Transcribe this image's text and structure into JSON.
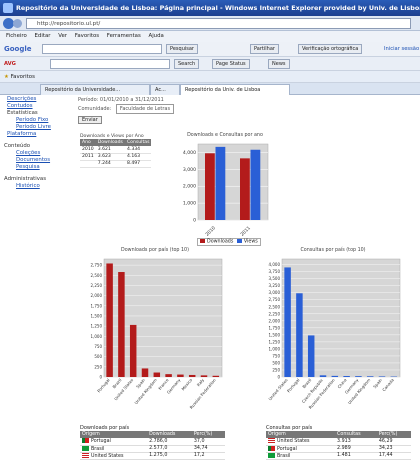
{
  "window": {
    "title": "Repositório da Universidade de Lisboa: Página principal - Windows Internet Explorer provided by Univ. de Lisboa - Reitoria"
  },
  "address": {
    "url": "http://repositorio.ul.pt/"
  },
  "menu": [
    "Ficheiro",
    "Editar",
    "Ver",
    "Favoritos",
    "Ferramentas",
    "Ajuda"
  ],
  "google": {
    "label": "Google",
    "search_label": "Pesquisar",
    "bookmarks": "Partilhar",
    "proof": "Verificação ortográfica",
    "signin": "Iniciar sessão"
  },
  "avg": {
    "label": "AVG",
    "search_btn": "Search",
    "status": "Page Status",
    "news": "News"
  },
  "favorites": {
    "label": "Favoritos"
  },
  "tabs": [
    "Repositório da Universidade...",
    "Ac...",
    "Repositório da Univ. de Lisboa"
  ],
  "sidebar": {
    "items": [
      {
        "label": "Descrições",
        "level": 1
      },
      {
        "label": "Contudos",
        "level": 1
      },
      {
        "label": "Estatísticas",
        "level": 1
      },
      {
        "label": "Período Fixo",
        "level": 2
      },
      {
        "label": "Período Livre",
        "level": 2
      },
      {
        "label": "Plataforma",
        "level": 1
      }
    ],
    "section2": "Conteúdo",
    "items2": [
      {
        "label": "Coleções"
      },
      {
        "label": "Documentos"
      },
      {
        "label": "Pesquisa"
      }
    ],
    "section3": "Administrativas",
    "items3": [
      {
        "label": "Histórico"
      }
    ]
  },
  "meta": {
    "period": "Período: 01/01/2010 a 31/12/2011",
    "community": "Comunidade:",
    "community_value": "Faculdade de Letras",
    "button": "Enviar"
  },
  "summary": {
    "title": "Downloads e Views por Ano",
    "headers": [
      "Ano",
      "Downloads",
      "Consultas"
    ],
    "rows": [
      [
        "2010",
        "3.621",
        "4.334"
      ],
      [
        "2011",
        "3.623",
        "4.163"
      ],
      [
        "",
        "7.244",
        "8.497"
      ]
    ]
  },
  "chart_data": [
    {
      "type": "bar",
      "title": "Downloads e Consultas por ano",
      "categories": [
        "2010",
        "2011"
      ],
      "series": [
        {
          "name": "Downloads",
          "values": [
            3950,
            3650
          ],
          "color": "#b31b1b"
        },
        {
          "name": "Views",
          "values": [
            4330,
            4160
          ],
          "color": "#2a5fd6"
        }
      ],
      "ylim": [
        0,
        4500
      ],
      "ticks": [
        "0",
        "1,000",
        "2,000",
        "3,000",
        "4,000"
      ]
    },
    {
      "type": "bar",
      "title": "Downloads por país (top 10)",
      "categories": [
        "Portugal",
        "Brazil",
        "United States",
        "Spain",
        "United Kingdom",
        "France",
        "Germany",
        "Mexico",
        "Italy",
        "Russian Federation"
      ],
      "values": [
        2790,
        2580,
        1280,
        210,
        110,
        70,
        60,
        50,
        40,
        30
      ],
      "color": "#b31b1b",
      "ylim": [
        0,
        2900
      ],
      "ticks": [
        "0",
        "250",
        "500",
        "750",
        "1,000",
        "1,250",
        "1,500",
        "1,750",
        "2,000",
        "2,250",
        "2,500",
        "2,750"
      ]
    },
    {
      "type": "bar",
      "title": "Consultas por país (top 10)",
      "categories": [
        "United States",
        "Portugal",
        "Brazil",
        "Czech Republic",
        "Russian Federation",
        "China",
        "Germany",
        "United Kingdom",
        "Spain",
        "Canada"
      ],
      "values": [
        3900,
        2980,
        1480,
        60,
        40,
        35,
        30,
        25,
        20,
        15
      ],
      "color": "#2a5fd6",
      "ylim": [
        0,
        4200
      ],
      "ticks": [
        "0",
        "250",
        "500",
        "750",
        "1,000",
        "1,250",
        "1,500",
        "1,750",
        "2,000",
        "2,250",
        "2,500",
        "2,750",
        "3,000",
        "3,250",
        "3,500",
        "3,750",
        "4,000"
      ]
    }
  ],
  "legend": {
    "downloads": "Downloads",
    "views": "Views"
  },
  "table_downloads": {
    "title": "Downloads por país",
    "headers": [
      "Origem",
      "Downloads",
      "Perc(%)"
    ],
    "rows": [
      {
        "flag": "pt",
        "country": "Portugal",
        "value": "2.786,0",
        "pct": "37,0"
      },
      {
        "flag": "br",
        "country": "Brasil",
        "value": "2.577,0",
        "pct": "34,74"
      },
      {
        "flag": "us",
        "country": "United States",
        "value": "1.275,0",
        "pct": "17,2"
      }
    ]
  },
  "table_views": {
    "title": "Consultas por país",
    "headers": [
      "Origem",
      "Consultas",
      "Perc(%)"
    ],
    "rows": [
      {
        "flag": "us",
        "country": "United States",
        "value": "3.913",
        "pct": "46,29"
      },
      {
        "flag": "pt",
        "country": "Portugal",
        "value": "2.989",
        "pct": "34,23"
      },
      {
        "flag": "br",
        "country": "Brasil",
        "value": "1.481",
        "pct": "17,44"
      }
    ]
  }
}
